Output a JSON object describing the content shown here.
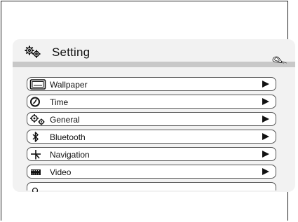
{
  "header": {
    "title": "Setting"
  },
  "menu": {
    "items": [
      {
        "label": "Wallpaper",
        "icon": "wallpaper-icon"
      },
      {
        "label": "Time",
        "icon": "clock-icon"
      },
      {
        "label": "General",
        "icon": "gears-icon"
      },
      {
        "label": "Bluetooth",
        "icon": "bluetooth-icon"
      },
      {
        "label": "Navigation",
        "icon": "navigation-icon"
      },
      {
        "label": "Video",
        "icon": "film-icon"
      }
    ],
    "partial_item": {
      "icon": "search-icon"
    }
  },
  "colors": {
    "panel": "#f2f2f2",
    "header_bar": "#c8c8c8",
    "text": "#111111"
  }
}
